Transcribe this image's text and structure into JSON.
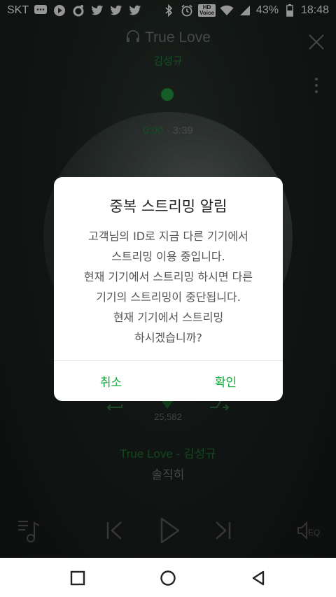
{
  "status_bar": {
    "carrier": "SKT",
    "battery": "43%",
    "time": "18:48",
    "hd_label_top": "HD",
    "hd_label_bottom": "Voice",
    "icons": [
      "chat-icon",
      "play-icon",
      "music-app-icon",
      "twitter-icon",
      "twitter-icon",
      "twitter-icon",
      "bluetooth-icon",
      "alarm-icon",
      "hd-voice-icon",
      "wifi-icon",
      "signal-icon",
      "battery-icon"
    ]
  },
  "player": {
    "title": "True Love",
    "artist": "김성규",
    "current_time": "0:00",
    "time_separator": " · ",
    "total_time": "3:39",
    "like_count": "25,582",
    "now_playing_line": "True Love - 김성규",
    "album_line": "솔직히",
    "accent_color": "#1f8f3c",
    "bottom_controls": [
      "playlist-icon",
      "previous-icon",
      "play-icon",
      "next-icon",
      "eq-icon"
    ]
  },
  "dialog": {
    "title": "중복 스트리밍 알림",
    "message_lines": [
      "고객님의 ID로 지금 다른 기기에서",
      "스트리밍 이용 중입니다.",
      "현재 기기에서 스트리밍 하시면 다른",
      "기기의 스트리밍이 중단됩니다.",
      "현재 기기에서 스트리밍",
      "하시겠습니까?"
    ],
    "cancel_label": "취소",
    "confirm_label": "확인",
    "button_color": "#12a83a"
  },
  "nav_bar": {
    "buttons": [
      "recents-square-icon",
      "home-circle-icon",
      "back-triangle-icon"
    ]
  }
}
